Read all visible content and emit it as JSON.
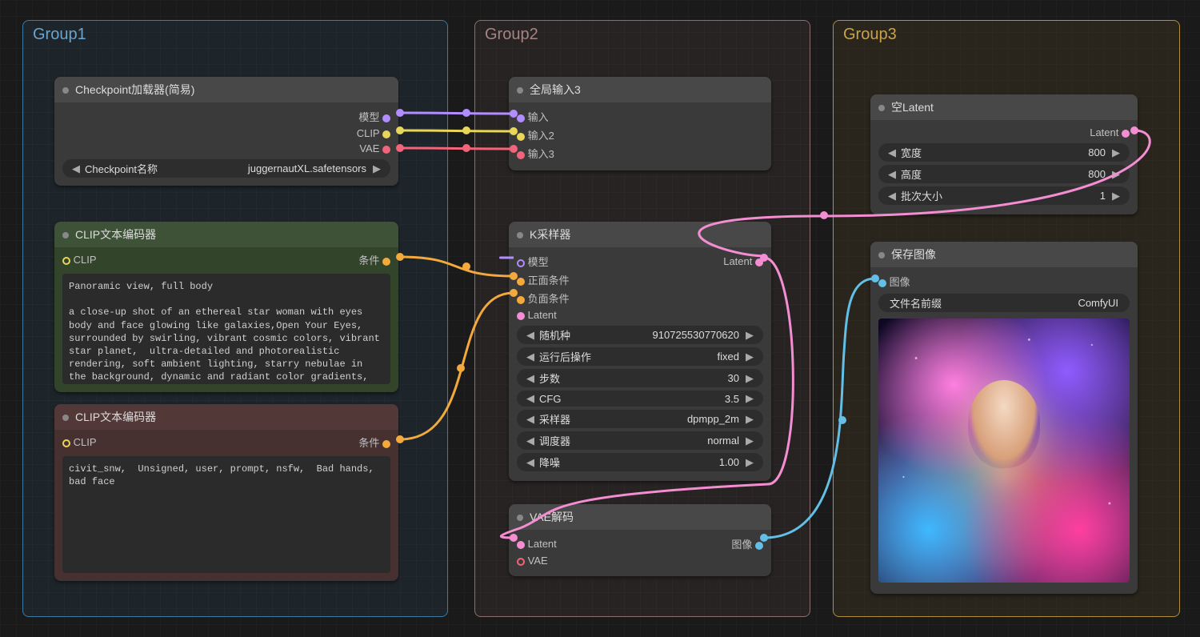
{
  "groups": {
    "g1": {
      "label": "Group1"
    },
    "g2": {
      "label": "Group2"
    },
    "g3": {
      "label": "Group3"
    }
  },
  "checkpoint": {
    "title": "Checkpoint加载器(简易)",
    "out_model": "模型",
    "out_clip": "CLIP",
    "out_vae": "VAE",
    "field_label": "Checkpoint名称",
    "field_value": "juggernautXL.safetensors"
  },
  "clip_pos": {
    "title": "CLIP文本编码器",
    "in_clip": "CLIP",
    "out_cond": "条件",
    "text": "Panoramic view, full body\n\na close-up shot of an ethereal star woman with eyes body and face glowing like galaxies,Open Your Eyes,  surrounded by swirling, vibrant cosmic colors, vibrant star planet,  ultra-detailed and photorealistic rendering, soft ambient lighting, starry nebulae in the background, dynamic and radiant color gradients, glowing reflections, cinematic composition, surreal and otherworldly atmosphere, intricate facial features, flowing hair infused with cosmic energy, luminous and ethereal, celestial radiance, soft yet"
  },
  "clip_neg": {
    "title": "CLIP文本编码器",
    "in_clip": "CLIP",
    "out_cond": "条件",
    "text": "civit_snw,  Unsigned, user, prompt, nsfw,  Bad hands, bad face"
  },
  "global_in": {
    "title": "全局输入3",
    "i1": "输入",
    "i2": "输入2",
    "i3": "输入3"
  },
  "ksampler": {
    "title": "K采样器",
    "in_model": "模型",
    "in_pos": "正面条件",
    "in_neg": "负面条件",
    "in_latent": "Latent",
    "out_latent": "Latent",
    "seed_label": "随机种",
    "seed_val": "910725530770620",
    "after_label": "运行后操作",
    "after_val": "fixed",
    "steps_label": "步数",
    "steps_val": "30",
    "cfg_label": "CFG",
    "cfg_val": "3.5",
    "sampler_label": "采样器",
    "sampler_val": "dpmpp_2m",
    "scheduler_label": "调度器",
    "scheduler_val": "normal",
    "denoise_label": "降噪",
    "denoise_val": "1.00"
  },
  "vae_decode": {
    "title": "VAE解码",
    "in_latent": "Latent",
    "in_vae": "VAE",
    "out_image": "图像"
  },
  "empty_latent": {
    "title": "空Latent",
    "out_latent": "Latent",
    "w_label": "宽度",
    "w_val": "800",
    "h_label": "高度",
    "h_val": "800",
    "batch_label": "批次大小",
    "batch_val": "1"
  },
  "save": {
    "title": "保存图像",
    "in_image": "图像",
    "prefix_label": "文件名前缀",
    "prefix_val": "ComfyUI"
  }
}
